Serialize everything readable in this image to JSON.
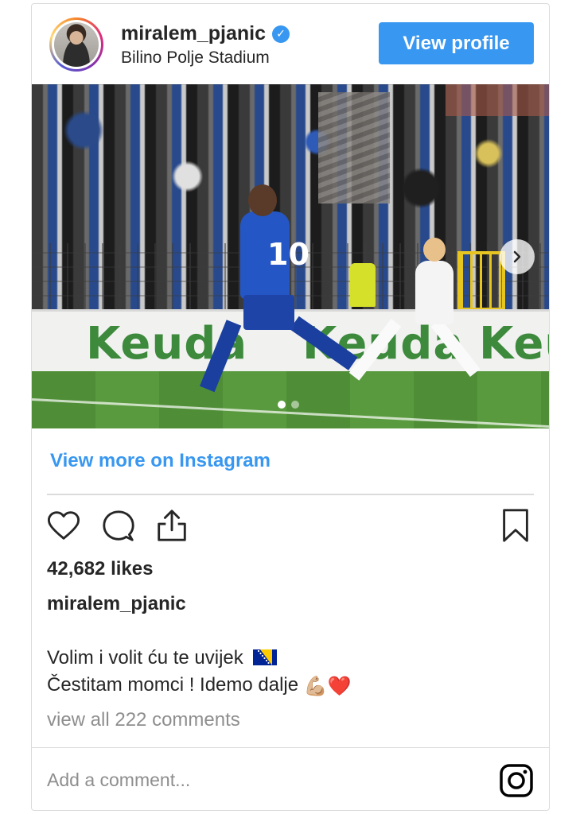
{
  "header": {
    "username": "miralem_pjanic",
    "verified_icon": "verified-check-icon",
    "location": "Bilino Polje Stadium",
    "view_profile_label": "View profile"
  },
  "photo": {
    "board_text_1": "Keuda",
    "board_text_2": "Keuda",
    "board_text_3": "Keu",
    "jersey_number": "10",
    "carousel_dots": 2,
    "active_dot": 1
  },
  "view_more_label": "View more on Instagram",
  "actions": {
    "like_icon": "heart-icon",
    "comment_icon": "comment-icon",
    "share_icon": "share-icon",
    "save_icon": "bookmark-icon"
  },
  "likes_text": "42,682 likes",
  "caption": {
    "username": "miralem_pjanic",
    "line1": "Volim i volit ću te uvijek",
    "line2": "Čestitam momci ! Idemo dalje",
    "line2_emoji": "💪🏼❤️"
  },
  "comments_link": "view all 222 comments",
  "add_comment_placeholder": "Add a comment...",
  "colors": {
    "accent": "#3897f0",
    "text": "#262626",
    "muted": "#8e8e8e",
    "border": "#dbdbdb"
  }
}
